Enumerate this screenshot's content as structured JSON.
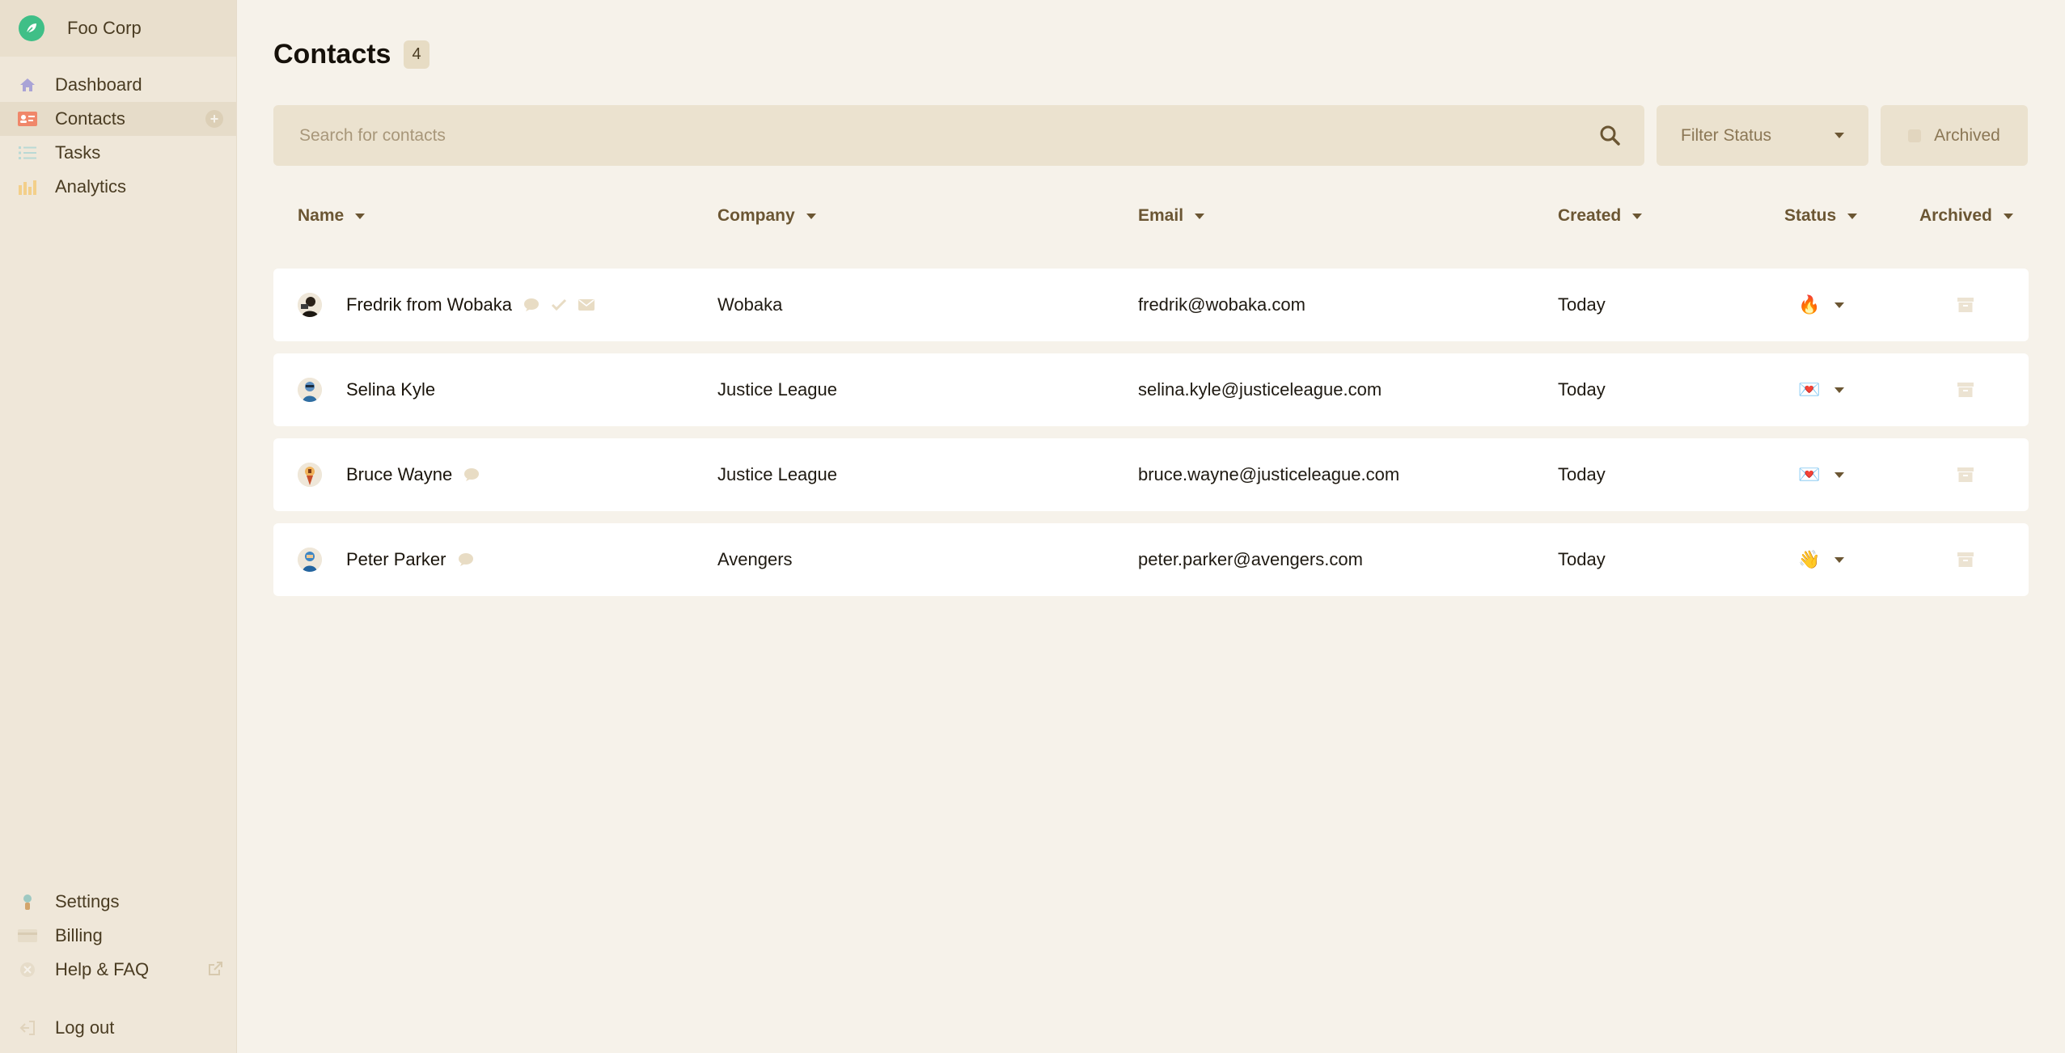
{
  "org": {
    "name": "Foo Corp"
  },
  "nav": {
    "items": [
      {
        "label": "Dashboard",
        "icon": "home-icon"
      },
      {
        "label": "Contacts",
        "icon": "contact-card-icon",
        "active": true
      },
      {
        "label": "Tasks",
        "icon": "checklist-icon"
      },
      {
        "label": "Analytics",
        "icon": "bar-chart-icon"
      }
    ],
    "bottom": [
      {
        "label": "Settings",
        "icon": "person-gear-icon"
      },
      {
        "label": "Billing",
        "icon": "credit-card-icon"
      },
      {
        "label": "Help & FAQ",
        "icon": "help-icon"
      }
    ],
    "logout": "Log out"
  },
  "page": {
    "title": "Contacts",
    "count": "4"
  },
  "toolbar": {
    "search_placeholder": "Search for contacts",
    "filter_label": "Filter Status",
    "archived_label": "Archived"
  },
  "table": {
    "columns": [
      "Name",
      "Company",
      "Email",
      "Created",
      "Status",
      "Archived"
    ],
    "rows": [
      {
        "name": "Fredrik from Wobaka",
        "company": "Wobaka",
        "email": "fredrik@wobaka.com",
        "created": "Today",
        "status": "🔥",
        "icons": [
          "chat-bubble-icon",
          "check-icon",
          "mail-icon"
        ]
      },
      {
        "name": "Selina Kyle",
        "company": "Justice League",
        "email": "selina.kyle@justiceleague.com",
        "created": "Today",
        "status": "💌",
        "icons": []
      },
      {
        "name": "Bruce Wayne",
        "company": "Justice League",
        "email": "bruce.wayne@justiceleague.com",
        "created": "Today",
        "status": "💌",
        "icons": [
          "chat-bubble-icon"
        ]
      },
      {
        "name": "Peter Parker",
        "company": "Avengers",
        "email": "peter.parker@avengers.com",
        "created": "Today",
        "status": "👋",
        "icons": [
          "chat-bubble-icon"
        ]
      }
    ]
  },
  "colors": {
    "brand": "#3fbf87",
    "background": "#f6f2ea",
    "sidebar": "#efe7d9",
    "accent_text": "#6b5633"
  }
}
